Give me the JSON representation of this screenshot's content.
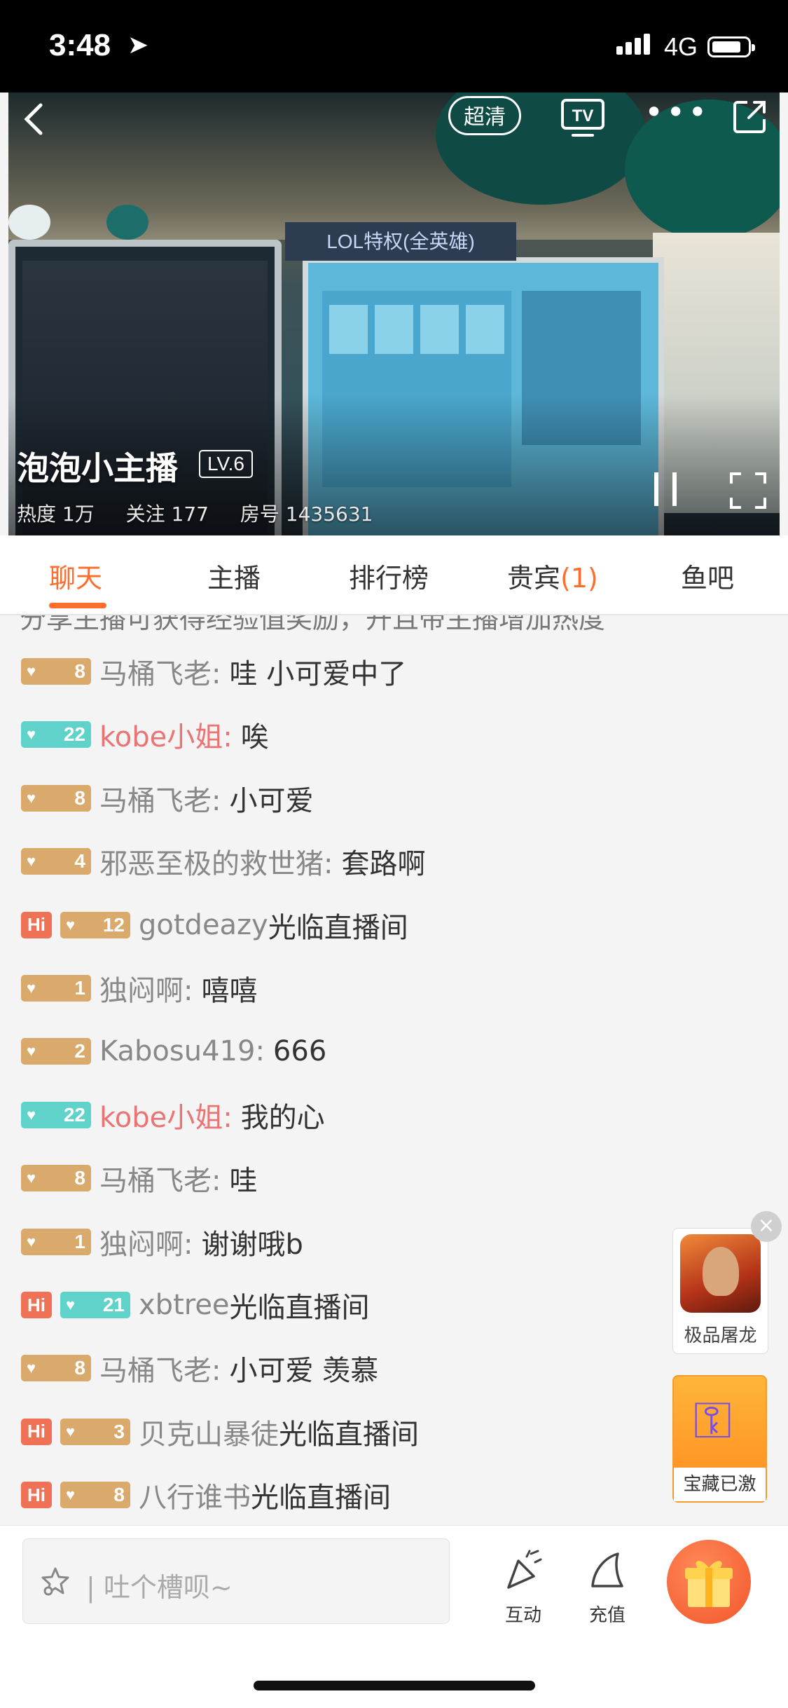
{
  "status_bar": {
    "time": "3:48",
    "location_icon": "location-arrow",
    "network": "4G"
  },
  "player": {
    "quality_label": "超清",
    "tv_label": "TV",
    "streamer_name": "泡泡小主播",
    "level": "LV.6",
    "stats": {
      "heat": "热度 1万",
      "follow": "关注 177",
      "room": "房号 1435631"
    },
    "video_sign": "LOL特权(全英雄)"
  },
  "tabs": [
    {
      "label": "聊天"
    },
    {
      "label": "主播"
    },
    {
      "label": "排行榜"
    },
    {
      "label": "贵宾",
      "count": "(1)"
    },
    {
      "label": "鱼吧"
    }
  ],
  "chat": {
    "cut_line": "分享主播可获得经验值奖励，开且带主播增加热度",
    "messages": [
      {
        "hi": false,
        "level": "8",
        "badge_color": "#d9aa6b",
        "user": "马桶飞老:",
        "vip": false,
        "text": "哇 小可爱中了"
      },
      {
        "hi": false,
        "level": "22",
        "badge_color": "#5fd3c9",
        "user": "kobe小姐:",
        "vip": true,
        "text": "唉"
      },
      {
        "hi": false,
        "level": "8",
        "badge_color": "#d9aa6b",
        "user": "马桶飞老:",
        "vip": false,
        "text": "小可爱"
      },
      {
        "hi": false,
        "level": "4",
        "badge_color": "#d9aa6b",
        "user": "邪恶至极的救世猪:",
        "vip": false,
        "text": "套路啊"
      },
      {
        "hi": true,
        "level": "12",
        "badge_color": "#d9aa6b",
        "user": "gotdeazy",
        "vip": false,
        "text": "光临直播间"
      },
      {
        "hi": false,
        "level": "1",
        "badge_color": "#d9aa6b",
        "user": "独闷啊:",
        "vip": false,
        "text": "嘻嘻"
      },
      {
        "hi": false,
        "level": "2",
        "badge_color": "#d9aa6b",
        "user": "Kabosu419:",
        "vip": false,
        "text": "666"
      },
      {
        "hi": false,
        "level": "22",
        "badge_color": "#5fd3c9",
        "user": "kobe小姐:",
        "vip": true,
        "text": "我的心"
      },
      {
        "hi": false,
        "level": "8",
        "badge_color": "#d9aa6b",
        "user": "马桶飞老:",
        "vip": false,
        "text": "哇"
      },
      {
        "hi": false,
        "level": "1",
        "badge_color": "#d9aa6b",
        "user": "独闷啊:",
        "vip": false,
        "text": "谢谢哦b"
      },
      {
        "hi": true,
        "level": "21",
        "badge_color": "#5fd3c9",
        "user": "xbtree",
        "vip": false,
        "text": "光临直播间"
      },
      {
        "hi": false,
        "level": "8",
        "badge_color": "#d9aa6b",
        "user": "马桶飞老:",
        "vip": false,
        "text": "小可爱 羡慕"
      },
      {
        "hi": true,
        "level": "3",
        "badge_color": "#d9aa6b",
        "user": "贝克山暴徒",
        "vip": false,
        "text": "光临直播间"
      },
      {
        "hi": true,
        "level": "8",
        "badge_color": "#d9aa6b",
        "user": "八行谁书",
        "vip": false,
        "text": "光临直播间"
      }
    ],
    "hi_label": "Hi"
  },
  "ads": {
    "game_label": "极品屠龙",
    "treasure_label": "宝藏已激",
    "close_symbol": "×"
  },
  "bottom": {
    "placeholder": "吐个槽呗~",
    "interact_label": "互动",
    "recharge_label": "充值"
  },
  "colors": {
    "accent": "#ff6d2d",
    "vip_name": "#ea7474",
    "fan_badge": "#d9aa6b",
    "noble_badge": "#5fd3c9"
  }
}
